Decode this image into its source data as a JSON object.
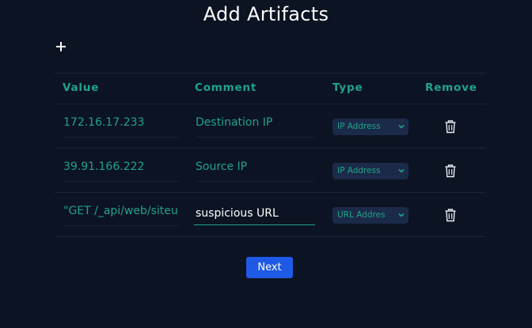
{
  "title": "Add Artifacts",
  "add_icon": "plus-icon",
  "table": {
    "headers": {
      "value": "Value",
      "comment": "Comment",
      "type": "Type",
      "remove": "Remove"
    },
    "rows": [
      {
        "value": "172.16.17.233",
        "comment": "Destination IP",
        "type": "IP Address",
        "remove_icon": "trash-icon"
      },
      {
        "value": "39.91.166.222",
        "comment": "Source IP",
        "type": "IP Address",
        "remove_icon": "trash-icon"
      },
      {
        "value": "\"GET /_api/web/siteu",
        "comment": "suspicious URL",
        "type": "URL Addres",
        "remove_icon": "trash-icon"
      }
    ]
  },
  "next_label": "Next",
  "colors": {
    "background": "#0c1322",
    "accent": "#1fa38a",
    "select_bg": "#1b2a48",
    "button": "#1f5ae6"
  }
}
